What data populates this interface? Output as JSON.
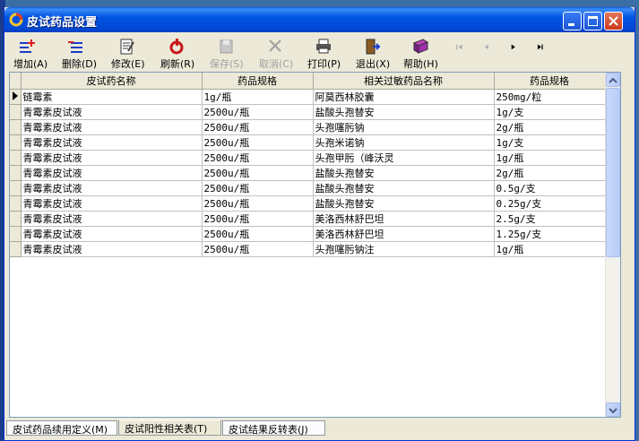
{
  "window": {
    "title": "皮试药品设置"
  },
  "toolbar": {
    "add": "增加(A)",
    "delete": "删除(D)",
    "edit": "修改(E)",
    "refresh": "刷新(R)",
    "save": "保存(S)",
    "cancel": "取消(C)",
    "print": "打印(P)",
    "exit": "退出(X)",
    "help": "帮助(H)"
  },
  "grid": {
    "columns": [
      "皮试药名称",
      "药品规格",
      "相关过敏药品名称",
      "药品规格"
    ],
    "rows": [
      [
        "链霉素",
        "1g/瓶",
        "阿莫西林胶囊",
        "250mg/粒"
      ],
      [
        "青霉素皮试液",
        "2500u/瓶",
        "盐酸头孢替安",
        "1g/支"
      ],
      [
        "青霉素皮试液",
        "2500u/瓶",
        "头孢噻肟钠",
        "2g/瓶"
      ],
      [
        "青霉素皮试液",
        "2500u/瓶",
        "头孢米诺钠",
        "1g/支"
      ],
      [
        "青霉素皮试液",
        "2500u/瓶",
        "头孢甲肟（峰沃灵",
        "1g/瓶"
      ],
      [
        "青霉素皮试液",
        "2500u/瓶",
        "盐酸头孢替安",
        "2g/瓶"
      ],
      [
        "青霉素皮试液",
        "2500u/瓶",
        "盐酸头孢替安",
        "0.5g/支"
      ],
      [
        "青霉素皮试液",
        "2500u/瓶",
        "盐酸头孢替安",
        "0.25g/支"
      ],
      [
        "青霉素皮试液",
        "2500u/瓶",
        "美洛西林舒巴坦",
        "2.5g/支"
      ],
      [
        "青霉素皮试液",
        "2500u/瓶",
        "美洛西林舒巴坦",
        "1.25g/支"
      ],
      [
        "青霉素皮试液",
        "2500u/瓶",
        "头孢噻肟钠注",
        "1g/瓶"
      ]
    ]
  },
  "tabs": [
    "皮试药品续用定义(M)",
    "皮试阳性相关表(T)",
    "皮试结果反转表(J)"
  ],
  "colors": {
    "titlebar": "#0054e3",
    "window_bg": "#ece9d8",
    "grid_border": "#7f9db9"
  }
}
